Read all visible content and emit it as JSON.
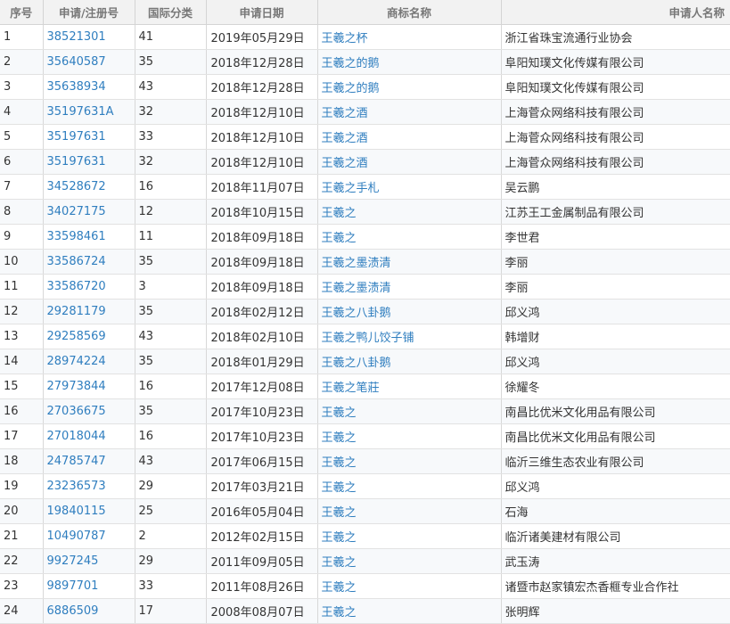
{
  "headers": [
    "序号",
    "申请/注册号",
    "国际分类",
    "申请日期",
    "商标名称",
    "申请人名称"
  ],
  "rows": [
    {
      "idx": "1",
      "reg": "38521301",
      "cls": "41",
      "date": "2019年05月29日",
      "tm": "王羲之杯",
      "app": "浙江省珠宝流通行业协会"
    },
    {
      "idx": "2",
      "reg": "35640587",
      "cls": "35",
      "date": "2018年12月28日",
      "tm": "王羲之的鹅",
      "app": "阜阳知璞文化传媒有限公司"
    },
    {
      "idx": "3",
      "reg": "35638934",
      "cls": "43",
      "date": "2018年12月28日",
      "tm": "王羲之的鹅",
      "app": "阜阳知璞文化传媒有限公司"
    },
    {
      "idx": "4",
      "reg": "35197631A",
      "cls": "32",
      "date": "2018年12月10日",
      "tm": "王羲之酒",
      "app": "上海菅众网络科技有限公司"
    },
    {
      "idx": "5",
      "reg": "35197631",
      "cls": "33",
      "date": "2018年12月10日",
      "tm": "王羲之酒",
      "app": "上海菅众网络科技有限公司"
    },
    {
      "idx": "6",
      "reg": "35197631",
      "cls": "32",
      "date": "2018年12月10日",
      "tm": "王羲之酒",
      "app": "上海菅众网络科技有限公司"
    },
    {
      "idx": "7",
      "reg": "34528672",
      "cls": "16",
      "date": "2018年11月07日",
      "tm": "王羲之手札",
      "app": "吴云鹏"
    },
    {
      "idx": "8",
      "reg": "34027175",
      "cls": "12",
      "date": "2018年10月15日",
      "tm": "王羲之",
      "app": "江苏王工金属制品有限公司"
    },
    {
      "idx": "9",
      "reg": "33598461",
      "cls": "11",
      "date": "2018年09月18日",
      "tm": "王羲之",
      "app": "李世君"
    },
    {
      "idx": "10",
      "reg": "33586724",
      "cls": "35",
      "date": "2018年09月18日",
      "tm": "王羲之墨渍清",
      "app": "李丽"
    },
    {
      "idx": "11",
      "reg": "33586720",
      "cls": "3",
      "date": "2018年09月18日",
      "tm": "王羲之墨渍清",
      "app": "李丽"
    },
    {
      "idx": "12",
      "reg": "29281179",
      "cls": "35",
      "date": "2018年02月12日",
      "tm": "王羲之八卦鹅",
      "app": "邱义鸿"
    },
    {
      "idx": "13",
      "reg": "29258569",
      "cls": "43",
      "date": "2018年02月10日",
      "tm": "王羲之鸭儿饺子铺",
      "app": "韩增财"
    },
    {
      "idx": "14",
      "reg": "28974224",
      "cls": "35",
      "date": "2018年01月29日",
      "tm": "王羲之八卦鹅",
      "app": "邱义鸿"
    },
    {
      "idx": "15",
      "reg": "27973844",
      "cls": "16",
      "date": "2017年12月08日",
      "tm": "王羲之笔莊",
      "app": "徐耀冬"
    },
    {
      "idx": "16",
      "reg": "27036675",
      "cls": "35",
      "date": "2017年10月23日",
      "tm": "王羲之",
      "app": "南昌比优米文化用品有限公司"
    },
    {
      "idx": "17",
      "reg": "27018044",
      "cls": "16",
      "date": "2017年10月23日",
      "tm": "王羲之",
      "app": "南昌比优米文化用品有限公司"
    },
    {
      "idx": "18",
      "reg": "24785747",
      "cls": "43",
      "date": "2017年06月15日",
      "tm": "王羲之",
      "app": "临沂三维生态农业有限公司"
    },
    {
      "idx": "19",
      "reg": "23236573",
      "cls": "29",
      "date": "2017年03月21日",
      "tm": "王羲之",
      "app": "邱义鸿"
    },
    {
      "idx": "20",
      "reg": "19840115",
      "cls": "25",
      "date": "2016年05月04日",
      "tm": "王羲之",
      "app": "石海"
    },
    {
      "idx": "21",
      "reg": "10490787",
      "cls": "2",
      "date": "2012年02月15日",
      "tm": "王羲之",
      "app": "临沂诸美建材有限公司"
    },
    {
      "idx": "22",
      "reg": "9927245",
      "cls": "29",
      "date": "2011年09月05日",
      "tm": "王羲之",
      "app": "武玉涛"
    },
    {
      "idx": "23",
      "reg": "9897701",
      "cls": "33",
      "date": "2011年08月26日",
      "tm": "王羲之",
      "app": "诸暨市赵家镇宏杰香榧专业合作社"
    },
    {
      "idx": "24",
      "reg": "6886509",
      "cls": "17",
      "date": "2008年08月07日",
      "tm": "王羲之",
      "app": "张明辉"
    }
  ]
}
